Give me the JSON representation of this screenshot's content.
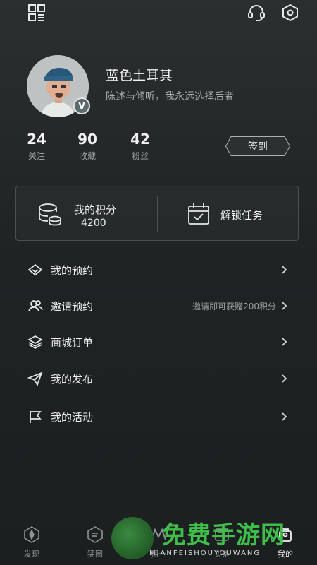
{
  "profile": {
    "username": "蓝色土耳其",
    "bio": "陈述与倾听，我永远选择后者",
    "badge": "V"
  },
  "stats": [
    {
      "value": "24",
      "label": "关注"
    },
    {
      "value": "90",
      "label": "收藏"
    },
    {
      "value": "42",
      "label": "粉丝"
    }
  ],
  "checkin_label": "签到",
  "card": {
    "points_label": "我的积分",
    "points_value": "4200",
    "tasks_label": "解锁任务"
  },
  "menu": [
    {
      "label": "我的预约",
      "hint": "",
      "icon": "diamond-icon"
    },
    {
      "label": "邀请预约",
      "hint": "邀请即可获赠200积分",
      "icon": "users-icon"
    },
    {
      "label": "商城订单",
      "hint": "",
      "icon": "layers-icon"
    },
    {
      "label": "我的发布",
      "hint": "",
      "icon": "send-icon"
    },
    {
      "label": "我的活动",
      "hint": "",
      "icon": "flag-icon"
    }
  ],
  "tabs": [
    {
      "label": "发现",
      "icon": "compass-icon"
    },
    {
      "label": "猛圈",
      "icon": "chat-icon"
    },
    {
      "label": "猛一",
      "icon": "m-icon"
    },
    {
      "label": "头条",
      "icon": "news-icon"
    },
    {
      "label": "我的",
      "icon": "profile-icon"
    }
  ],
  "watermark": {
    "title": "免费手游网",
    "subtitle": "MIANFEISHOUYOUWANG"
  },
  "colors": {
    "background": "#1f2324",
    "text": "#eef0f0",
    "muted": "#a0a6a6",
    "watermark_green": "#3fbf4a"
  }
}
